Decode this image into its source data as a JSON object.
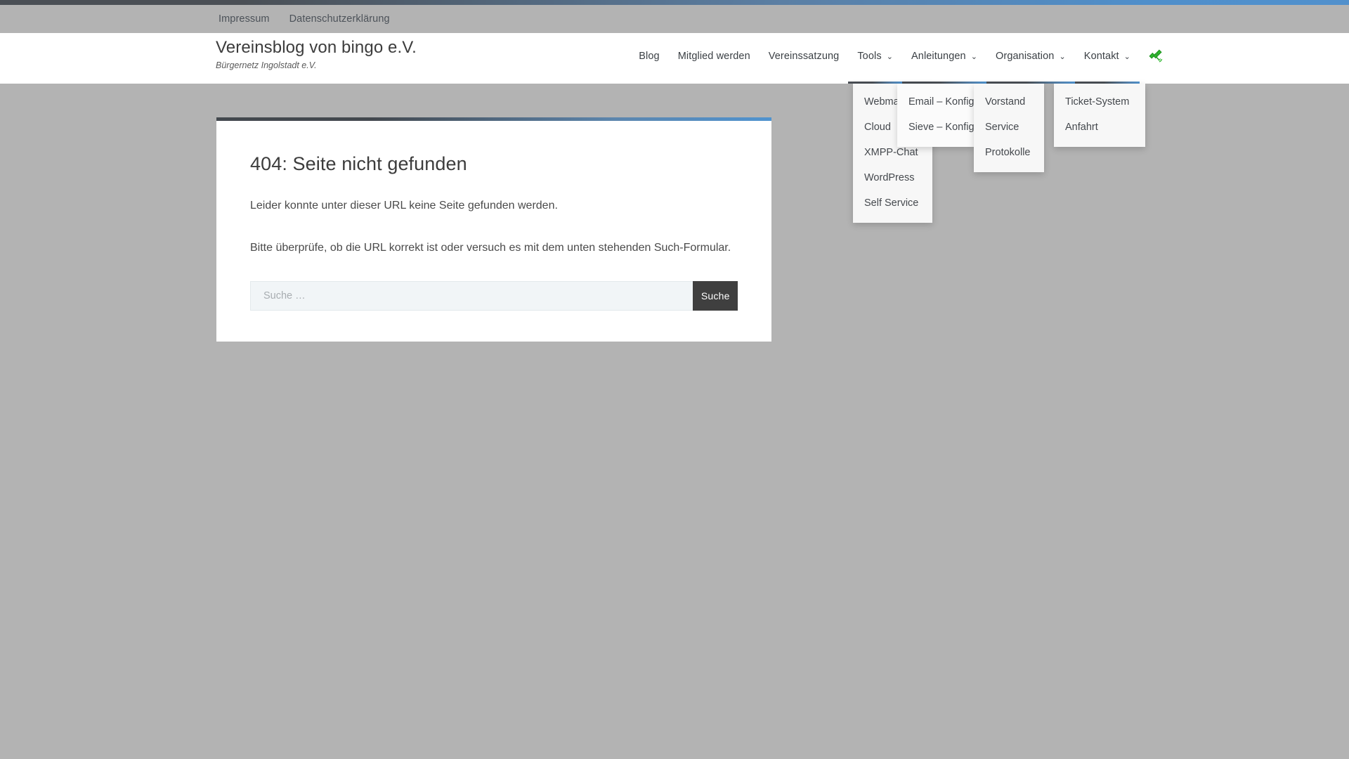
{
  "meta_bar": {
    "links": [
      {
        "label": "Impressum"
      },
      {
        "label": "Datenschutzerklärung"
      }
    ]
  },
  "header": {
    "site_title": "Vereinsblog von bingo e.V.",
    "tagline": "Bürgernetz Ingolstadt e.V.",
    "satellite_icon": "satellite-icon"
  },
  "nav": {
    "items": [
      {
        "label": "Blog",
        "has_caret": false,
        "open": false
      },
      {
        "label": "Mitglied werden",
        "has_caret": false,
        "open": false
      },
      {
        "label": "Vereinssatzung",
        "has_caret": false,
        "open": false
      },
      {
        "label": "Tools",
        "has_caret": true,
        "open": true
      },
      {
        "label": "Anleitungen",
        "has_caret": true,
        "open": true
      },
      {
        "label": "Organisation",
        "has_caret": true,
        "open": true
      },
      {
        "label": "Kontakt",
        "has_caret": true,
        "open": true
      }
    ],
    "caret_glyph": "⌄"
  },
  "dropdowns": {
    "tools": {
      "items": [
        {
          "label": "Webmail"
        },
        {
          "label": "Cloud"
        },
        {
          "label": "XMPP-Chat"
        },
        {
          "label": "WordPress"
        },
        {
          "label": "Self Service"
        }
      ]
    },
    "anleitungen": {
      "items": [
        {
          "label": "Email – Konfiguration"
        },
        {
          "label": "Sieve – Konfiguration"
        }
      ]
    },
    "organisation": {
      "items": [
        {
          "label": "Vorstand"
        },
        {
          "label": "Service"
        },
        {
          "label": "Protokolle"
        }
      ]
    },
    "kontakt": {
      "items": [
        {
          "label": "Ticket-System"
        },
        {
          "label": "Anfahrt"
        }
      ]
    }
  },
  "main": {
    "title": "404: Seite nicht gefunden",
    "paragraph_1": "Leider konnte unter dieser URL keine Seite gefunden werden.",
    "paragraph_2": "Bitte überprüfe, ob die URL korrekt ist oder versuch es mit dem unten stehenden Such-Formular.",
    "search": {
      "placeholder": "Suche …",
      "value": "",
      "submit_label": "Suche"
    }
  },
  "colors": {
    "page_background": "#b3b3b3",
    "card_background": "#ffffff",
    "accent_dark": "#43484e",
    "accent_blue": "#4f93cf",
    "button_dark": "#3f3f3f",
    "dropdown_background": "#f7f7f7",
    "satellite_green": "#2eb82e"
  }
}
